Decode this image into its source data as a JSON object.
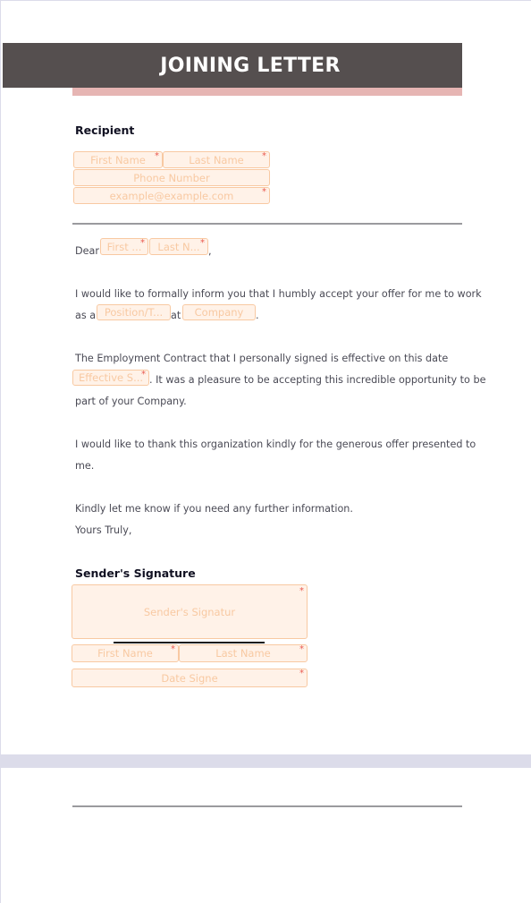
{
  "document": {
    "title": "JOINING LETTER",
    "colors": {
      "header_bg": "#554f4f",
      "header_accent": "#e6b5b3",
      "field_border": "#f8c9a2",
      "field_bg": "#fff2e8",
      "required_marker": "#e9584f"
    }
  },
  "recipient": {
    "section_title": "Recipient",
    "first_name_placeholder": "First Name",
    "last_name_placeholder": "Last Name",
    "phone_placeholder": "Phone Number",
    "email_placeholder": "example@example.com",
    "required_marker": "*"
  },
  "letter": {
    "dear_label": "Dear",
    "dear_first_placeholder": "First ...",
    "dear_last_placeholder": "Last N...",
    "dear_comma": ",",
    "para1_line1": "I would like to formally inform you that I humbly accept your offer for me to work",
    "para1_as_a": "as a",
    "position_placeholder": "Position/T...",
    "para1_at": "at",
    "company_placeholder": "Company",
    "para1_period": ".",
    "para2_line1": "The Employment Contract that I personally signed is effective on this date",
    "effective_date_placeholder": "Effective S...",
    "para2_line2_rest": ". It was a pleasure to be accepting this incredible opportunity to be",
    "para2_line3": "part of your Company.",
    "para3_line1": "I would like to thank this organization kindly for the generous offer presented to",
    "para3_line2": "me.",
    "para4_line1": "Kindly let me know if you need any further information.",
    "closing": "Yours Truly,"
  },
  "sender": {
    "section_title": "Sender's Signature",
    "signature_placeholder": "Sender's Signatur",
    "first_name_placeholder": "First Name",
    "last_name_placeholder": "Last Name",
    "date_signed_placeholder": "Date Signe",
    "required_marker": "*"
  }
}
